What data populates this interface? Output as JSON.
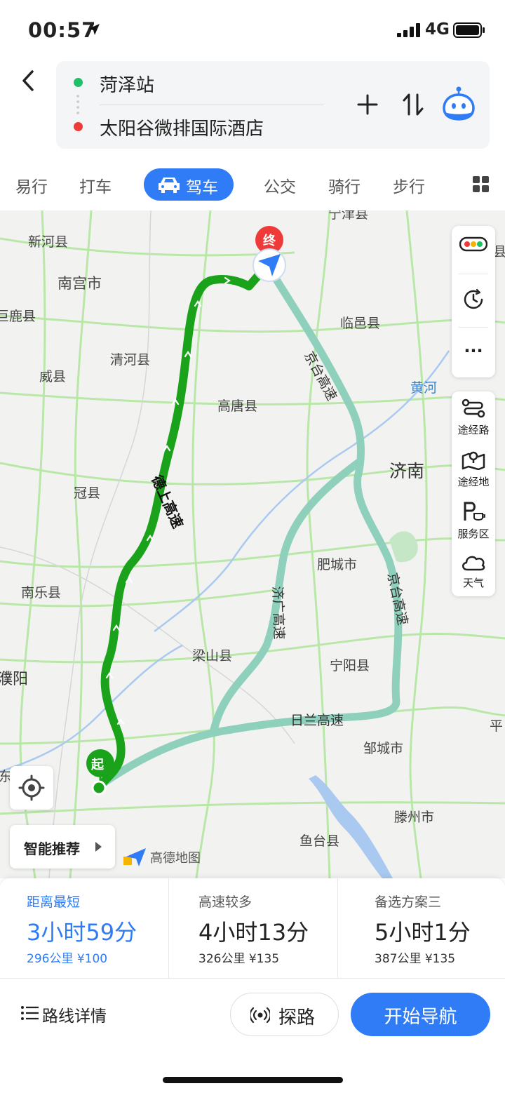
{
  "status_bar": {
    "time": "00:57",
    "network": "4G"
  },
  "route": {
    "origin": "菏泽站",
    "destination": "太阳谷微排国际酒店"
  },
  "tabs": [
    {
      "label": "易行"
    },
    {
      "label": "打车"
    },
    {
      "label": "驾车",
      "active": true
    },
    {
      "label": "公交"
    },
    {
      "label": "骑行"
    },
    {
      "label": "步行"
    }
  ],
  "map": {
    "start_marker": "起",
    "end_marker": "终",
    "labels": {
      "xinhe": "新河县",
      "nangong": "南宫市",
      "julu": "巨鹿县",
      "qinghe": "清河县",
      "weixian": "威县",
      "gaotang": "高唐县",
      "linyi": "临邑县",
      "jinan": "济南",
      "huanghe": "黄河",
      "guanxian": "冠县",
      "feicheng": "肥城市",
      "nanle": "南乐县",
      "liangshan": "梁山县",
      "ningyang": "宁阳县",
      "puyang": "濮阳",
      "zoucheng": "邹城市",
      "tengzhou": "滕州市",
      "yutai": "鱼台县",
      "dong": "东",
      "ping": "平",
      "jiu": "县",
      "top": "宁津县"
    },
    "highways": {
      "deshang": "德上高速",
      "jingtai_north": "京台高速",
      "jingtai_south": "京台高速",
      "jiguang": "济广高速",
      "rilan": "日兰高速"
    },
    "colors": {
      "selected_route": "#1aa31a",
      "alt_route": "#8fd0bd",
      "river": "#a9c9f0"
    }
  },
  "side_panel": {
    "traffic_icon": "traffic-light-icon",
    "history_icon": "clock-icon",
    "more": "···",
    "waypoint_road": "途经路",
    "waypoint_place": "途经地",
    "service_area": "服务区",
    "weather": "天气"
  },
  "smart_recommend": "智能推荐",
  "brand": "高德地图",
  "plans": [
    {
      "title": "距离最短",
      "duration": "3小时59分",
      "meta": "296公里  ¥100",
      "selected": true
    },
    {
      "title": "高速较多",
      "duration": "4小时13分",
      "meta": "326公里  ¥135"
    },
    {
      "title": "备选方案三",
      "duration": "5小时1分",
      "meta": "387公里  ¥135"
    }
  ],
  "bottom": {
    "route_details": "路线详情",
    "explore": "探路",
    "start_navigation": "开始导航"
  }
}
